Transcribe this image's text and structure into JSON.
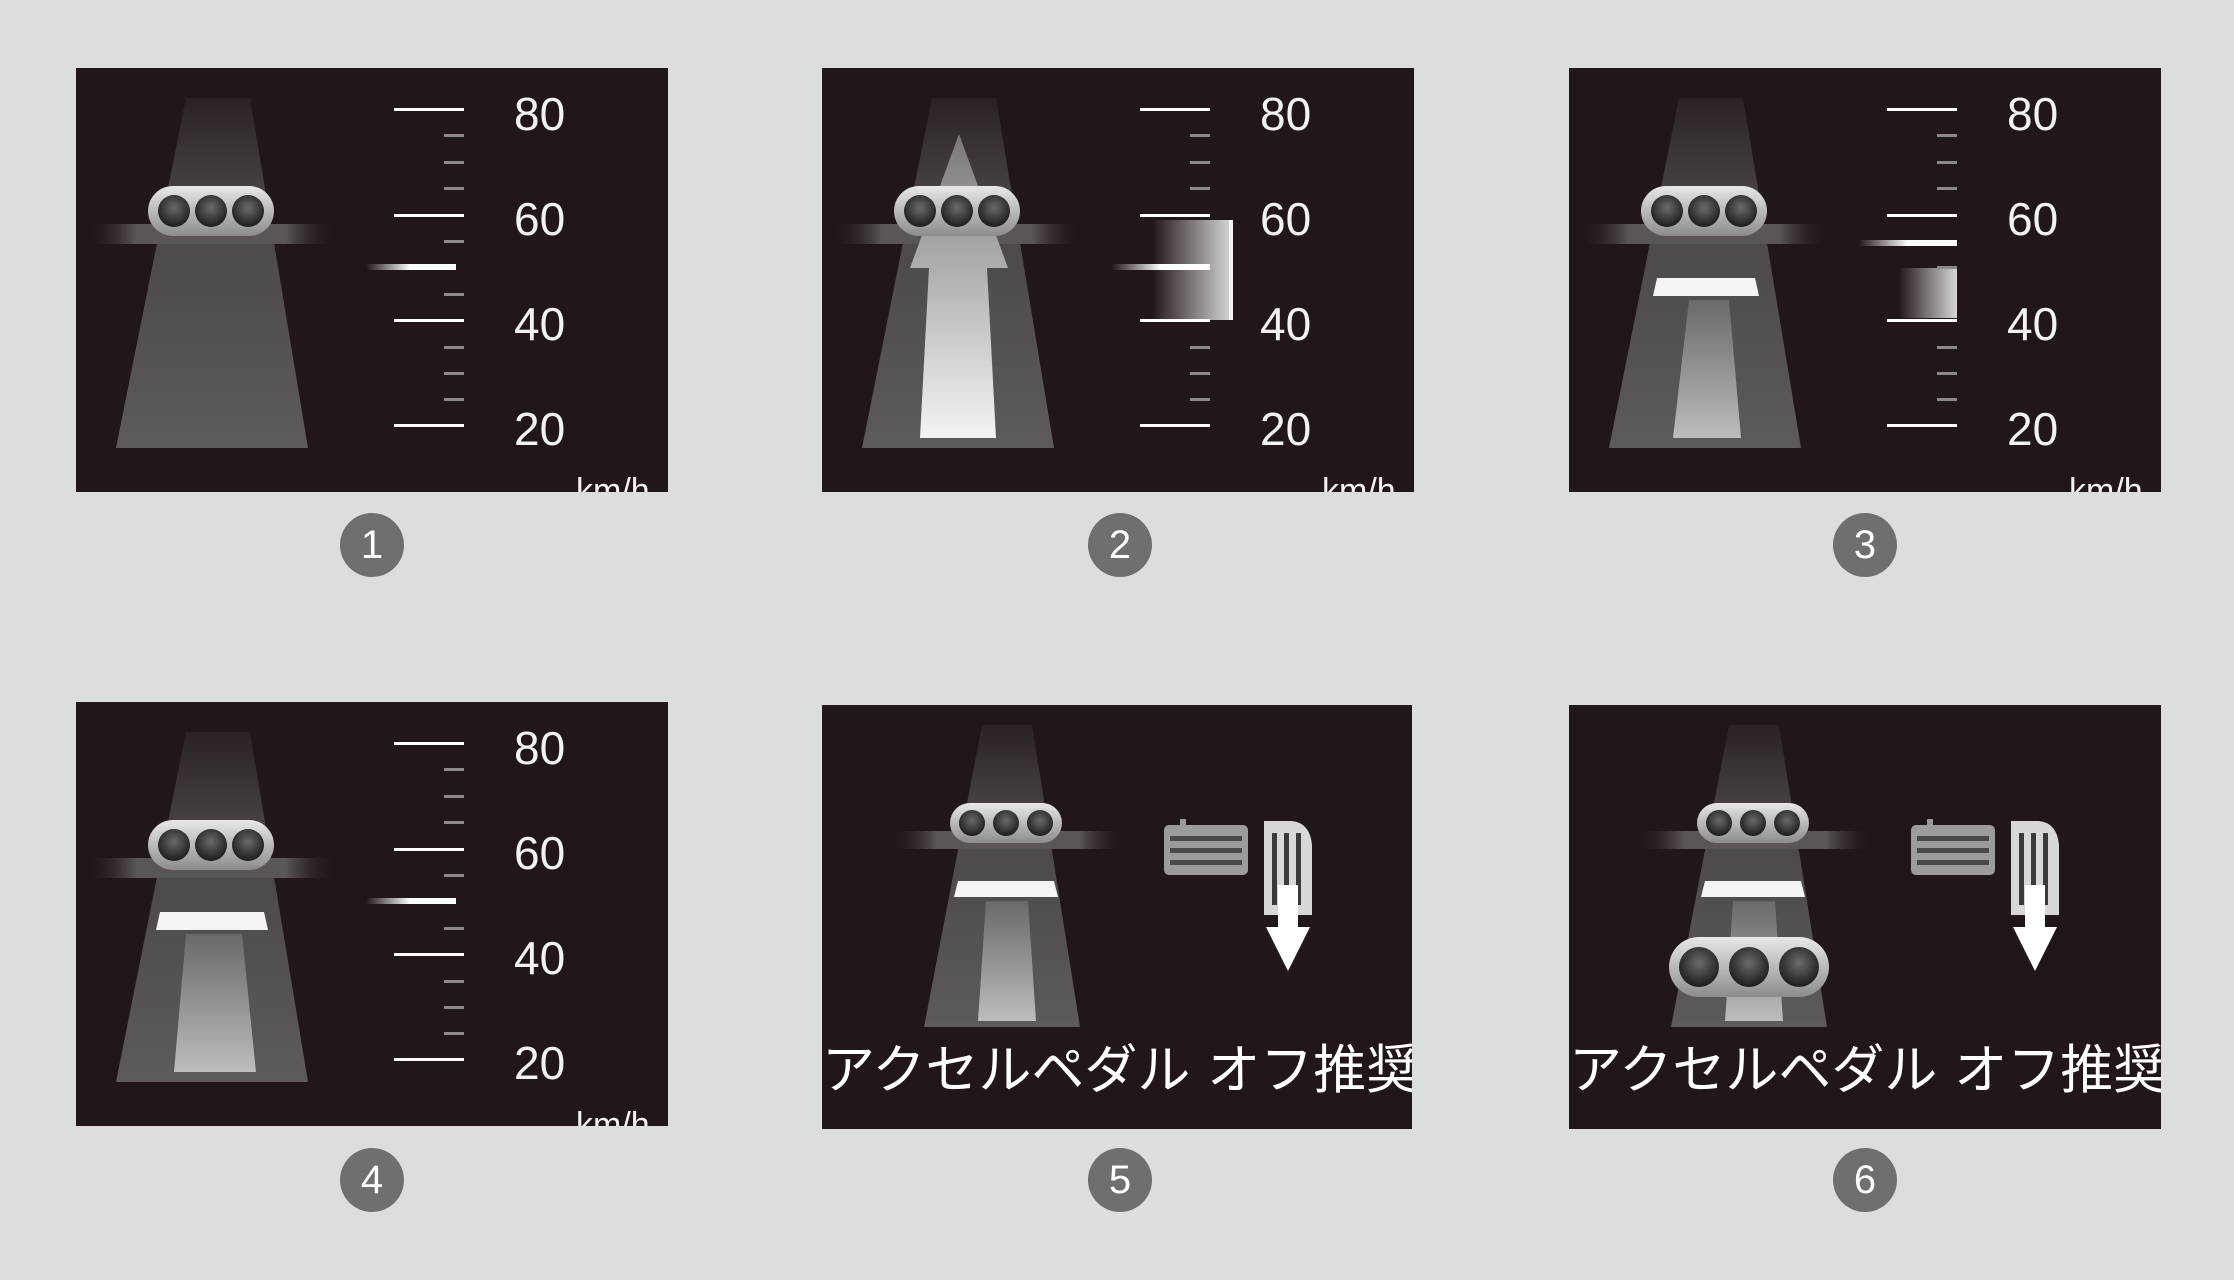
{
  "colors": {
    "background": "#dcdedd",
    "panel": "#221718",
    "badge": "#6f6f6f",
    "text": "#f2f2f2"
  },
  "speed_scale": {
    "labels": [
      "80",
      "60",
      "40",
      "20"
    ],
    "unit": "km/h"
  },
  "panels": [
    {
      "badge": "1"
    },
    {
      "badge": "2"
    },
    {
      "badge": "3"
    },
    {
      "badge": "4"
    },
    {
      "badge": "5",
      "message": "アクセルペダル オフ推奨"
    },
    {
      "badge": "6",
      "message": "アクセルペダル オフ推奨"
    }
  ],
  "icons": [
    "traffic-signal-icon",
    "brake-pedal-icon",
    "accelerator-pedal-icon",
    "release-arrow-icon"
  ]
}
